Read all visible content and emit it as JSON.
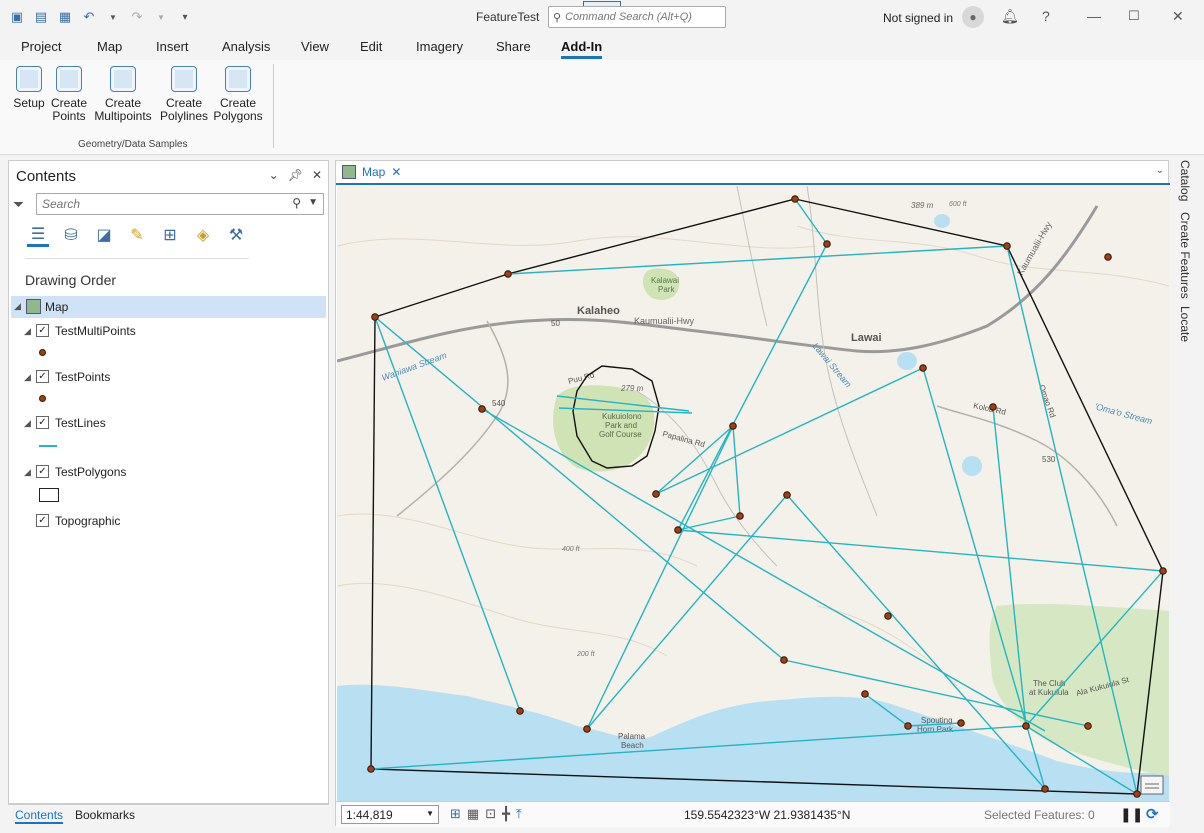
{
  "titlebar": {
    "app_title": "FeatureTest",
    "command_search_placeholder": "Command Search (Alt+Q)",
    "signin_label": "Not signed in",
    "help_label": "?",
    "quick_access_icons": [
      "new-project-icon",
      "open-folder-icon",
      "save-icon",
      "undo-icon",
      "redo-icon",
      "customize-icon"
    ]
  },
  "ribbon_tabs": [
    {
      "label": "Project",
      "active": false
    },
    {
      "label": "Map",
      "active": false
    },
    {
      "label": "Insert",
      "active": false
    },
    {
      "label": "Analysis",
      "active": false
    },
    {
      "label": "View",
      "active": false
    },
    {
      "label": "Edit",
      "active": false
    },
    {
      "label": "Imagery",
      "active": false
    },
    {
      "label": "Share",
      "active": false
    },
    {
      "label": "Add-In",
      "active": true
    }
  ],
  "ribbon": {
    "buttons": [
      {
        "line1": "Setup",
        "line2": ""
      },
      {
        "line1": "Create",
        "line2": "Points"
      },
      {
        "line1": "Create",
        "line2": "Multipoints"
      },
      {
        "line1": "Create",
        "line2": "Polylines"
      },
      {
        "line1": "Create",
        "line2": "Polygons"
      }
    ],
    "group_label": "Geometry/Data Samples"
  },
  "contents": {
    "title": "Contents",
    "search_placeholder": "Search",
    "drawing_order_label": "Drawing Order",
    "map_label": "Map",
    "layers": [
      {
        "name": "TestMultiPoints",
        "checked": true,
        "symbol": "point"
      },
      {
        "name": "TestPoints",
        "checked": true,
        "symbol": "point"
      },
      {
        "name": "TestLines",
        "checked": true,
        "symbol": "line"
      },
      {
        "name": "TestPolygons",
        "checked": true,
        "symbol": "polygon"
      },
      {
        "name": "Topographic",
        "checked": true,
        "symbol": "none"
      }
    ],
    "bottom_tabs": [
      {
        "label": "Contents",
        "active": true
      },
      {
        "label": "Bookmarks",
        "active": false
      }
    ]
  },
  "map": {
    "tab_label": "Map",
    "labels": {
      "kalaheo": "Kalaheo",
      "lawai": "Lawai",
      "kaumualii_hwy_1": "Kaumualii-Hwy",
      "kaumualii_hwy_2": "Kaumualii-Hwy",
      "route_50": "50",
      "route_540": "540",
      "route_530": "530",
      "kalawai_park_1": "Kalawai",
      "kalawai_park_2": "Park",
      "kukuiolono_1": "Kukuiolono",
      "kukuiolono_2": "Park and",
      "kukuiolono_3": "Golf Course",
      "elev_279": "279 m",
      "elev_389": "389 m",
      "elev_600": "600 ft",
      "elev_400": "400 ft",
      "elev_200": "200 ft",
      "puu_rd": "Puu Rd",
      "papalina_rd": "Papalina Rd",
      "koloa_rd": "Koloa Rd",
      "omao_rd": "Omao Rd",
      "omao_stream": "'Oma'o Stream",
      "lawai_stream": "Lawai Stream",
      "wahiawa_stream": "Wahiawa Stream",
      "club_kukuiula_1": "The Club",
      "club_kukuiula_2": "at Kukuiula",
      "spouting_1": "Spouting",
      "spouting_2": "Horn Park",
      "palama_1": "Palama",
      "palama_2": "Beach",
      "ala_kukuiula": "Ala Kukuiula St"
    }
  },
  "statusbar": {
    "scale": "1:44,819",
    "coordinates": "159.5542323°W 21.9381435°N",
    "selected_features": "Selected Features: 0"
  },
  "dock_tabs": [
    "Catalog",
    "Create Features",
    "Locate"
  ],
  "colors": {
    "accent": "#1a73c8",
    "line_color": "#22b5c4",
    "point_fill": "#a33d12",
    "water": "#b8e0f2",
    "land": "#f4f1ea",
    "park": "#cfe3b4"
  }
}
